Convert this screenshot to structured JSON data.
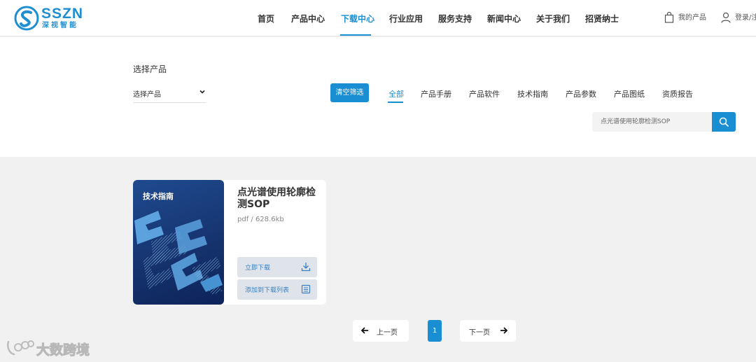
{
  "colors": {
    "accent": "#1a8ed3",
    "page_bg": "#f1f1f1",
    "card_button_bg": "#dfe4ea",
    "thumb_bg": "#163470"
  },
  "header": {
    "logo_text": "SSZN",
    "logo_subtext": "深视智能",
    "nav": [
      "首页",
      "产品中心",
      "下载中心",
      "行业应用",
      "服务支持",
      "新闻中心",
      "关于我们",
      "招贤纳士"
    ],
    "active_nav": "下载中心",
    "my_products": "我的产品",
    "login": "登录/注"
  },
  "filter": {
    "title": "选择产品",
    "select_value": "选择产品",
    "clear_button": "清空筛选",
    "categories": [
      "全部",
      "产品手册",
      "产品软件",
      "技术指南",
      "产品参数",
      "产品图纸",
      "资质报告"
    ],
    "active_category": "全部",
    "search_placeholder": "点光谱使用轮廓检测SOP"
  },
  "document": {
    "thumb_label": "技术指南",
    "title": "点光谱使用轮廓检测SOP",
    "meta": "pdf / 628.6kb",
    "download_button": "立即下载",
    "add_button": "添加到下载列表"
  },
  "pagination": {
    "prev": "上一页",
    "current": "1",
    "next": "下一页"
  },
  "watermark": "大数跨境",
  "icons": [
    "logo-icon",
    "bag-icon",
    "user-icon",
    "chevron-down-icon",
    "search-icon",
    "download-icon",
    "list-icon",
    "arrow-left-icon",
    "arrow-right-icon",
    "watermark-logo-icon"
  ]
}
